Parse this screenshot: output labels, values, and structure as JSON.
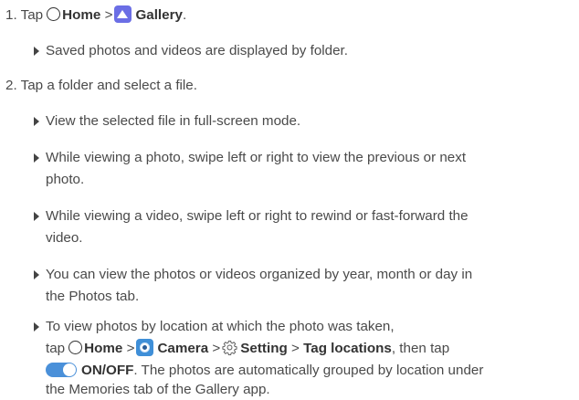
{
  "step1": {
    "number": "1.",
    "text_tap": "Tap",
    "home": "Home",
    "sep1": ">",
    "gallery": "Gallery",
    "end": "."
  },
  "bullet1": "Saved photos and videos are displayed by folder.",
  "step2": {
    "number": "2.",
    "text": "Tap a folder and select a file."
  },
  "bullet2": "View the selected file in full-screen mode.",
  "bullet3": {
    "line1": "While viewing a photo, swipe left or right to view the previous or next",
    "line2": "photo."
  },
  "bullet4": {
    "line1": "While viewing a video, swipe left or right to rewind or fast-forward the",
    "line2": "video."
  },
  "bullet5": {
    "line1": "You can view the photos or videos organized by year, month or day in",
    "line2": "the Photos tab."
  },
  "bullet6": {
    "line1": "To view photos by location at which the photo was taken,",
    "tap": "tap",
    "home": "Home",
    "sep1": ">",
    "camera": "Camera",
    "sep2": ">",
    "setting": "Setting",
    "sep3": ">",
    "tag_locations": "Tag locations",
    "then_tap": ", then tap",
    "onoff": "ON/OFF",
    "after_onoff": ". The photos are automatically grouped by location under",
    "line4": "the Memories tab of the Gallery app."
  },
  "icons": {
    "home": "home-circle-icon",
    "gallery": "gallery-icon",
    "camera": "camera-icon",
    "settings": "gear-icon",
    "toggle": "toggle-switch-icon"
  },
  "colors": {
    "gallery_icon": "#6b6ee5",
    "camera_icon": "#3f8fd8",
    "toggle_on": "#4a90d9"
  }
}
